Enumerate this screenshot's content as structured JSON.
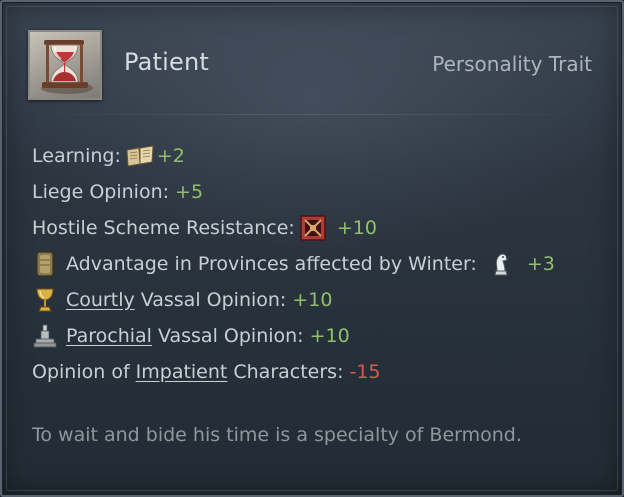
{
  "trait": {
    "name": "Patient",
    "type": "Personality Trait",
    "icon": "hourglass-icon"
  },
  "effects": [
    {
      "label": "Learning:",
      "icon": "book-icon",
      "value": "+2"
    },
    {
      "label": "Liege Opinion:",
      "value": "+5"
    },
    {
      "label": "Hostile Scheme Resistance:",
      "icon": "scheme-resistance-icon",
      "value": "+10"
    },
    {
      "lead_icon": "winter-banner-icon",
      "label": "Advantage in Provinces affected by Winter:",
      "icon": "knight-piece-icon",
      "value": "+3"
    },
    {
      "lead_icon": "goblet-icon",
      "link": "Courtly",
      "label": "Vassal Opinion:",
      "value": "+10"
    },
    {
      "lead_icon": "monument-icon",
      "link": "Parochial",
      "label": "Vassal Opinion:",
      "value": "+10"
    },
    {
      "prefix": "Opinion of",
      "link": "Impatient",
      "label": "Characters:",
      "value": "-15"
    }
  ],
  "flavor": "To wait and bide his time is a specialty of Bermond.",
  "colors": {
    "positive": "#8fc06b",
    "negative": "#e0574f",
    "text": "#c9ced3",
    "flavor": "#8f969d"
  }
}
